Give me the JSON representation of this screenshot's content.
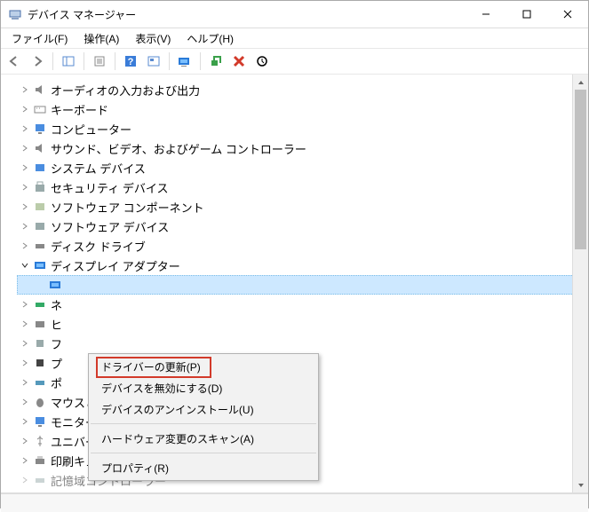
{
  "titlebar": {
    "title": "デバイス マネージャー"
  },
  "menubar": {
    "file": "ファイル(F)",
    "action": "操作(A)",
    "view": "表示(V)",
    "help": "ヘルプ(H)"
  },
  "tree": {
    "audio": "オーディオの入力および出力",
    "keyboard": "キーボード",
    "computer": "コンピューター",
    "svg": "サウンド、ビデオ、およびゲーム コントローラー",
    "system": "システム デバイス",
    "security": "セキュリティ デバイス",
    "swcomp": "ソフトウェア コンポーネント",
    "swdev": "ソフトウェア デバイス",
    "disk": "ディスク ドライブ",
    "display": "ディスプレイ アダプター",
    "display_child": " ",
    "net": "ネ",
    "hid": "ヒ",
    "fw": "フ",
    "proc": "プ",
    "port": "ポ",
    "mouse": "マウスとそのほかのポインティング デバイス",
    "monitor": "モニター",
    "usb": "ユニバーサル シリアル バス コントローラー",
    "print": "印刷キュー",
    "storage": "記憶域コントローラー"
  },
  "context": {
    "updateDriver": "ドライバーの更新(P)",
    "disable": "デバイスを無効にする(D)",
    "uninstall": "デバイスのアンインストール(U)",
    "scan": "ハードウェア変更のスキャン(A)",
    "properties": "プロパティ(R)"
  }
}
